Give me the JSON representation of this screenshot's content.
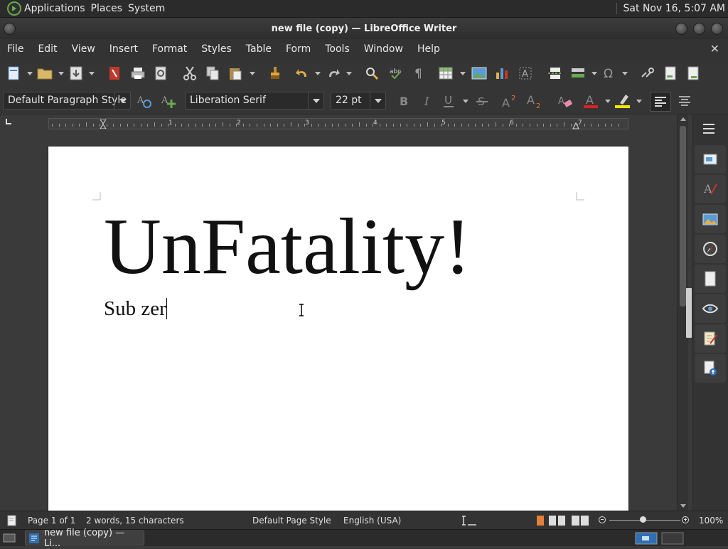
{
  "top_panel": {
    "menus": [
      "Applications",
      "Places",
      "System"
    ],
    "clock": "Sat Nov 16,  5:07 AM"
  },
  "window": {
    "title": "new file (copy) — LibreOffice Writer"
  },
  "menu_bar": {
    "items": [
      "File",
      "Edit",
      "View",
      "Insert",
      "Format",
      "Styles",
      "Table",
      "Form",
      "Tools",
      "Window",
      "Help"
    ]
  },
  "formatting": {
    "paragraph_style": "Default Paragraph Style",
    "font_name": "Liberation Serif",
    "font_size": "22 pt"
  },
  "ruler": {
    "numbers": [
      "1",
      "2",
      "3",
      "4",
      "5",
      "6",
      "7"
    ]
  },
  "document": {
    "heading": "UnFatality!",
    "subtext": "Sub zer"
  },
  "status_bar": {
    "page": "Page 1 of 1",
    "word_count": "2 words, 15 characters",
    "page_style": "Default Page Style",
    "language": "English (USA)",
    "zoom": "100%"
  },
  "taskbar": {
    "window_label": "new file (copy) — Li..."
  },
  "colors": {
    "accent_green": "#6aa84f",
    "font_color_red": "#e02020",
    "highlight_yellow": "#f2e600"
  }
}
